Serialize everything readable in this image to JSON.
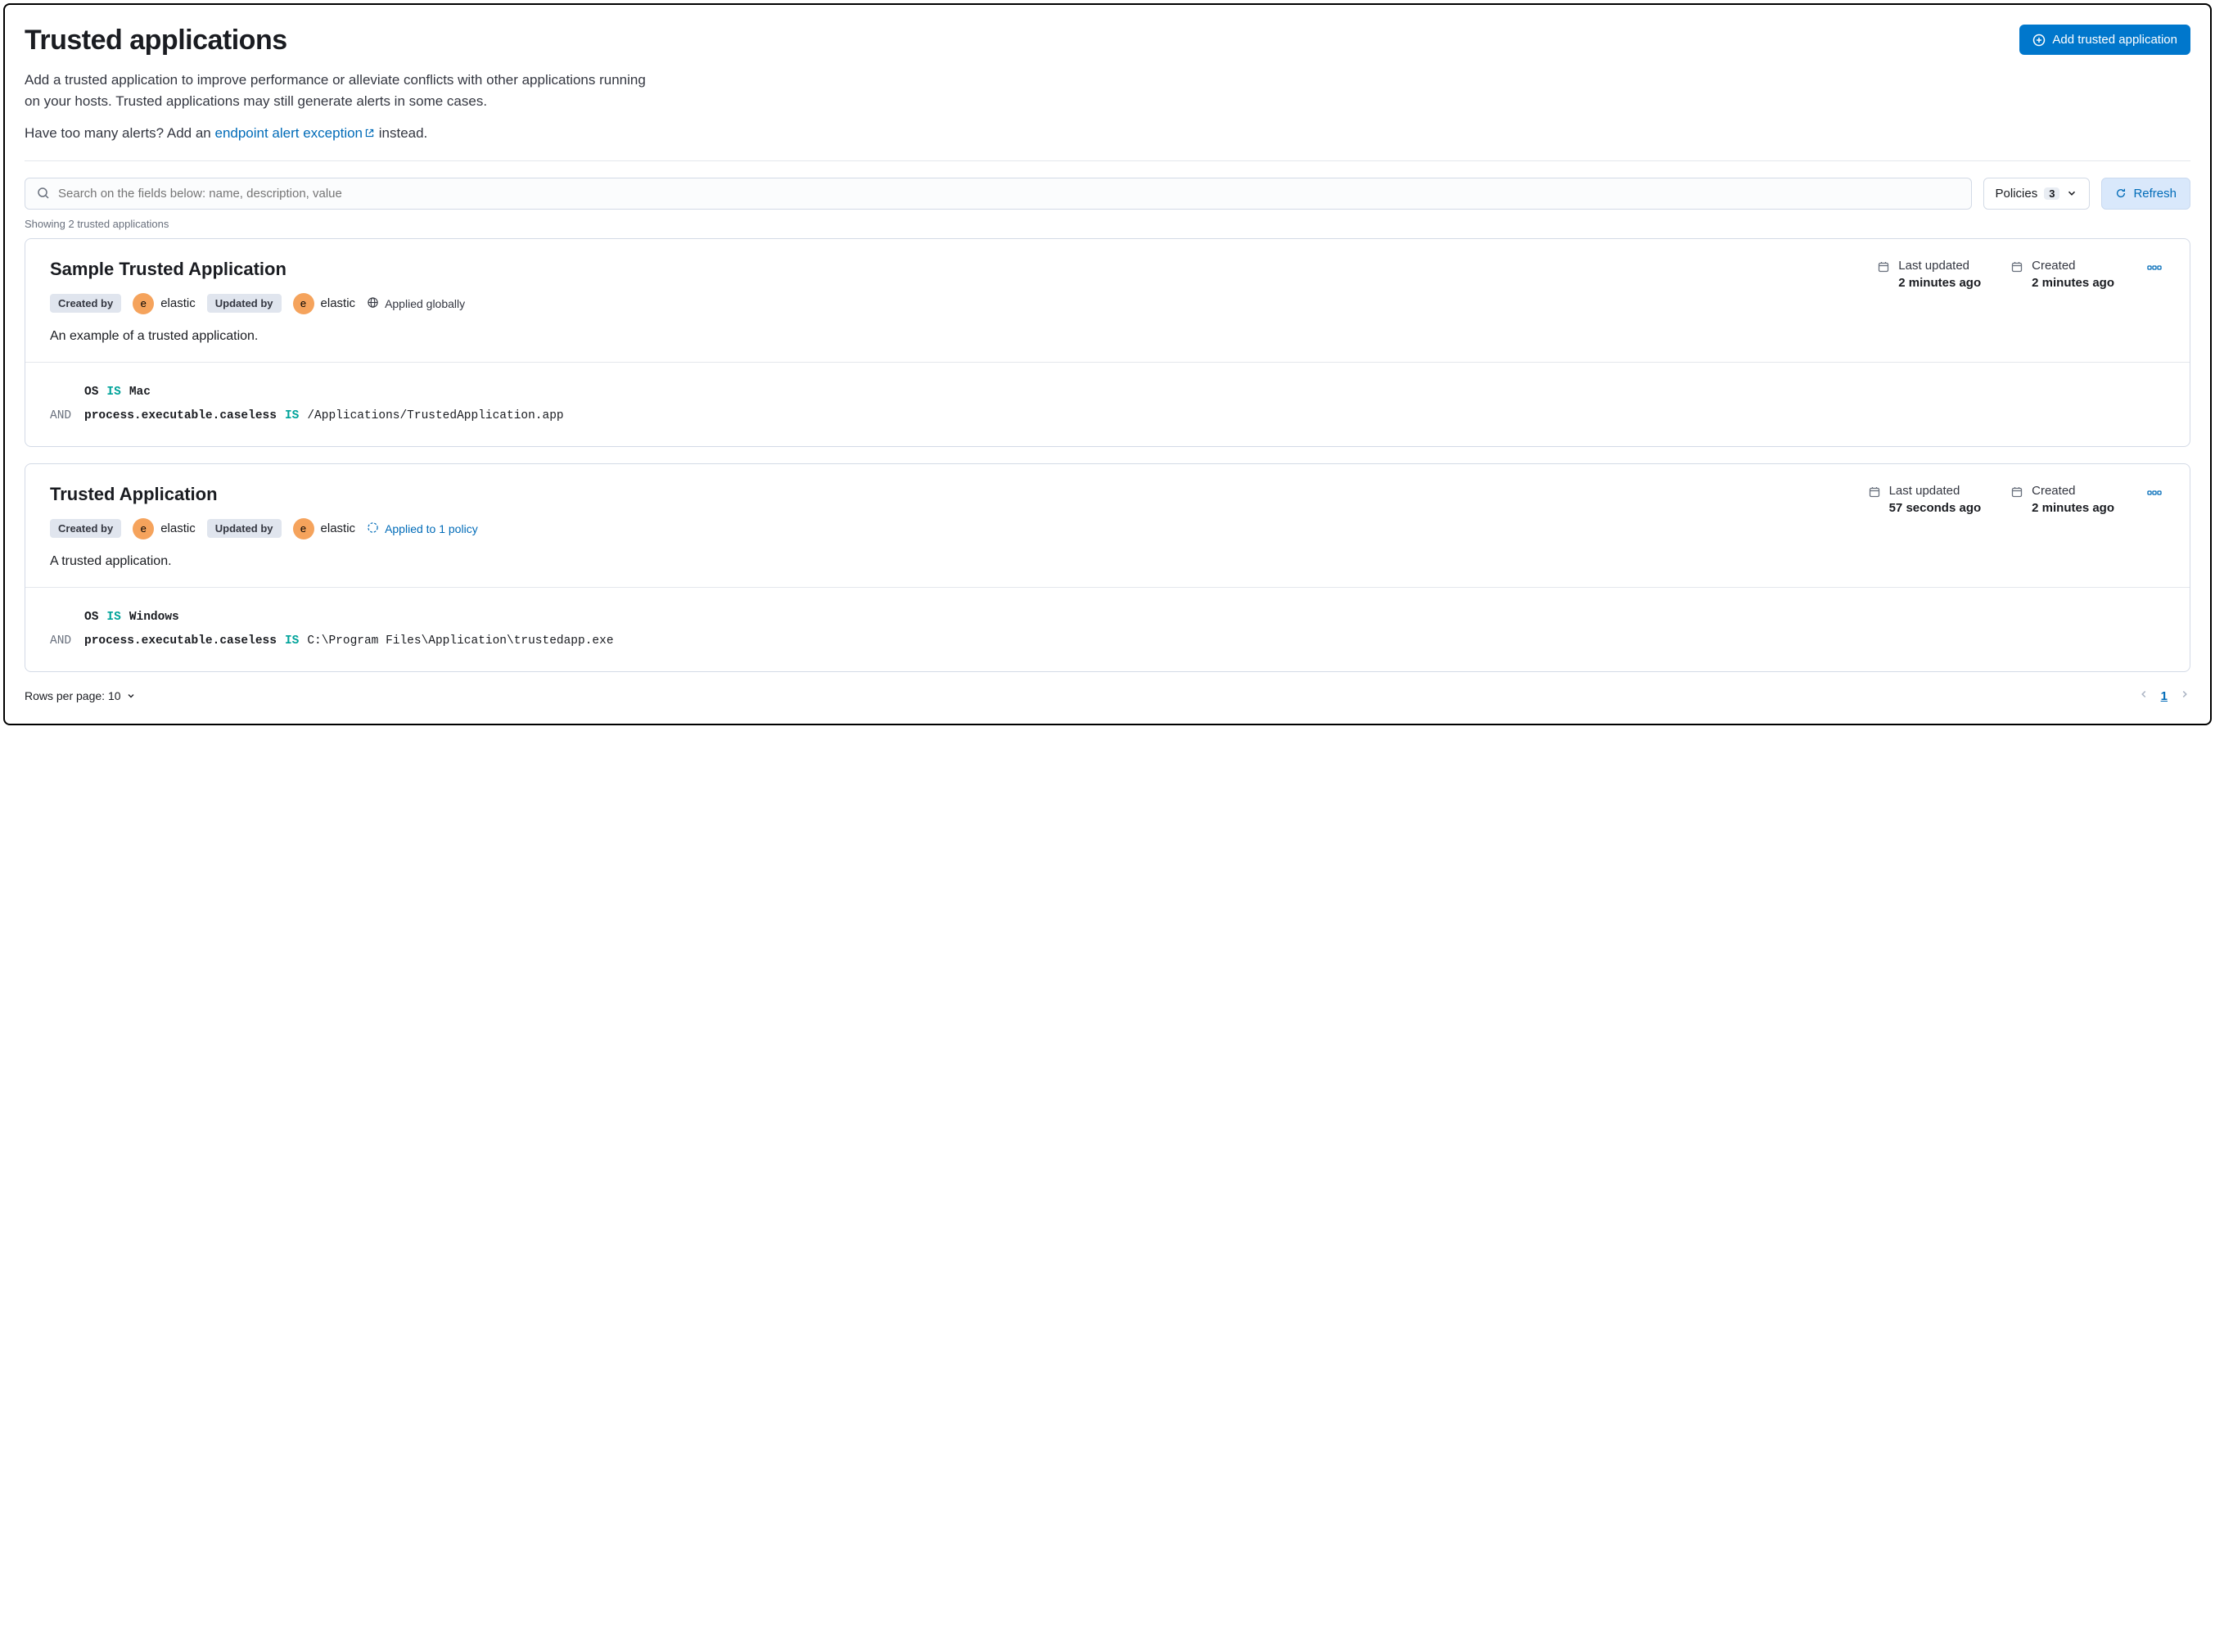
{
  "page": {
    "title": "Trusted applications",
    "add_button": "Add trusted application",
    "desc_line1": "Add a trusted application to improve performance or alleviate conflicts with other applications running on your hosts. Trusted applications may still generate alerts in some cases.",
    "desc_line2_prefix": "Have too many alerts? Add an ",
    "desc_line2_link": "endpoint alert exception",
    "desc_line2_suffix": " instead."
  },
  "search": {
    "placeholder": "Search on the fields below: name, description, value"
  },
  "policies_filter": {
    "label": "Policies",
    "count": "3"
  },
  "refresh_label": "Refresh",
  "showing_text": "Showing 2 trusted applications",
  "labels": {
    "created_by": "Created by",
    "updated_by": "Updated by",
    "last_updated": "Last updated",
    "created": "Created"
  },
  "cards": [
    {
      "title": "Sample Trusted Application",
      "created_by": {
        "initial": "e",
        "name": "elastic"
      },
      "updated_by": {
        "initial": "e",
        "name": "elastic"
      },
      "scope": {
        "type": "global",
        "text": "Applied globally"
      },
      "description": "An example of a trusted application.",
      "last_updated": "2 minutes ago",
      "created": "2 minutes ago",
      "conditions": [
        {
          "prefix": "",
          "field": "OS",
          "op": "IS",
          "value": "Mac"
        },
        {
          "prefix": "AND",
          "field": "process.executable.caseless",
          "op": "IS",
          "value": "/Applications/TrustedApplication.app"
        }
      ]
    },
    {
      "title": "Trusted Application",
      "created_by": {
        "initial": "e",
        "name": "elastic"
      },
      "updated_by": {
        "initial": "e",
        "name": "elastic"
      },
      "scope": {
        "type": "policy",
        "text": "Applied to 1 policy"
      },
      "description": "A trusted application.",
      "last_updated": "57 seconds ago",
      "created": "2 minutes ago",
      "conditions": [
        {
          "prefix": "",
          "field": "OS",
          "op": "IS",
          "value": "Windows"
        },
        {
          "prefix": "AND",
          "field": "process.executable.caseless",
          "op": "IS",
          "value": "C:\\Program Files\\Application\\trustedapp.exe"
        }
      ]
    }
  ],
  "footer": {
    "rows_per_page_label": "Rows per page: 10",
    "current_page": "1"
  }
}
